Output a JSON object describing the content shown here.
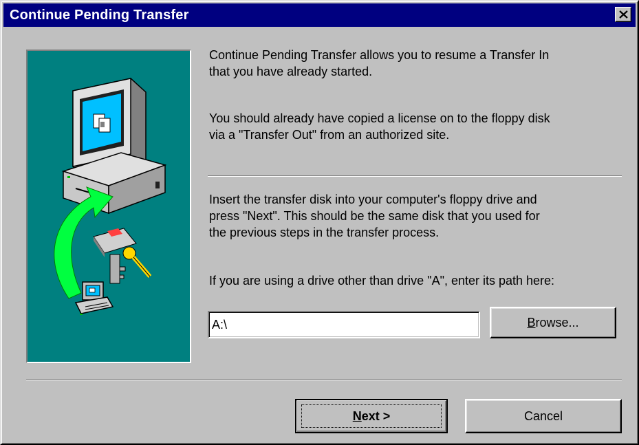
{
  "window": {
    "title": "Continue Pending Transfer",
    "close_glyph": "✕"
  },
  "content": {
    "intro_lines": [
      "Continue Pending Transfer allows you to resume a Transfer In",
      "that you have already started."
    ],
    "license_lines": [
      "You should already have copied a license on to the floppy disk",
      "via a \"Transfer Out\" from an authorized site."
    ],
    "insert_lines": [
      "Insert the transfer disk into your computer's floppy drive and",
      "press \"Next\". This should be the same disk that you used for",
      "the previous steps in the transfer process."
    ],
    "path_prompt": "If you are using a drive other than drive \"A\", enter its path here:",
    "path_value": "A:\\"
  },
  "buttons": {
    "browse": {
      "mnemonic": "B",
      "rest": "rowse..."
    },
    "next": {
      "mnemonic": "N",
      "rest": "ext >"
    },
    "cancel": "Cancel"
  },
  "illustration": {
    "icons": [
      "computer-monitor-icon",
      "green-arrow-icon",
      "floppy-keys-icon",
      "small-computer-icon"
    ]
  },
  "colors": {
    "titlebar": "#000080",
    "face": "#c0c0c0",
    "panel": "#008080",
    "arrow": "#00ff40"
  }
}
